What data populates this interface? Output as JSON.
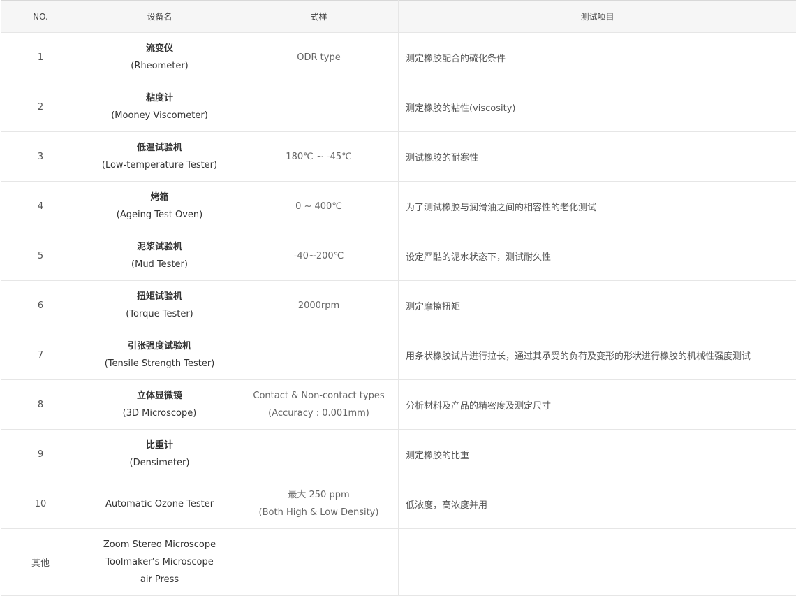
{
  "headers": {
    "no": "NO.",
    "name": "设备名",
    "spec": "式样",
    "test": "测试项目"
  },
  "rows": [
    {
      "no": "1",
      "name_zh": "流变仪",
      "name_en": "(Rheometer)",
      "spec1": "ODR type",
      "spec2": "",
      "test": "测定橡胶配合的硫化条件"
    },
    {
      "no": "2",
      "name_zh": "粘度计",
      "name_en": "(Mooney Viscometer)",
      "spec1": "",
      "spec2": "",
      "test": "测定橡胶的粘性(viscosity)"
    },
    {
      "no": "3",
      "name_zh": "低温试验机",
      "name_en": "(Low-temperature Tester)",
      "spec1": "180℃ ~ -45℃",
      "spec2": "",
      "test": "测试橡胶的耐寒性"
    },
    {
      "no": "4",
      "name_zh": "烤箱",
      "name_en": "(Ageing Test Oven)",
      "spec1": "0 ~ 400℃",
      "spec2": "",
      "test": "为了测试橡胶与润滑油之间的相容性的老化测试"
    },
    {
      "no": "5",
      "name_zh": "泥浆试验机",
      "name_en": "(Mud Tester)",
      "spec1": "-40~200℃",
      "spec2": "",
      "test": "设定严酷的泥水状态下，测试耐久性"
    },
    {
      "no": "6",
      "name_zh": "扭矩试验机",
      "name_en": "(Torque Tester)",
      "spec1": "2000rpm",
      "spec2": "",
      "test": "测定摩擦扭矩"
    },
    {
      "no": "7",
      "name_zh": "引张强度试验机",
      "name_en": "(Tensile Strength Tester)",
      "spec1": "",
      "spec2": "",
      "test": "用条状橡胶试片进行拉长，通过其承受的负荷及变形的形状进行橡胶的机械性强度测试"
    },
    {
      "no": "8",
      "name_zh": "立体显微镜",
      "name_en": "(3D Microscope)",
      "spec1": "Contact & Non-contact types",
      "spec2": "(Accuracy : 0.001mm)",
      "test": "分析材料及产品的精密度及测定尺寸"
    },
    {
      "no": "9",
      "name_zh": "比重计",
      "name_en": "(Densimeter)",
      "spec1": "",
      "spec2": "",
      "test": "测定橡胶的比重"
    },
    {
      "no": "10",
      "name_single": "Automatic Ozone Tester",
      "spec1": "最大 250 ppm",
      "spec2": "(Both High & Low Density)",
      "test": "低浓度，高浓度并用"
    }
  ],
  "other": {
    "no": "其他",
    "items": [
      "Zoom Stereo Microscope",
      "Toolmaker’s Microscope",
      "air Press"
    ],
    "spec": "",
    "test": ""
  }
}
